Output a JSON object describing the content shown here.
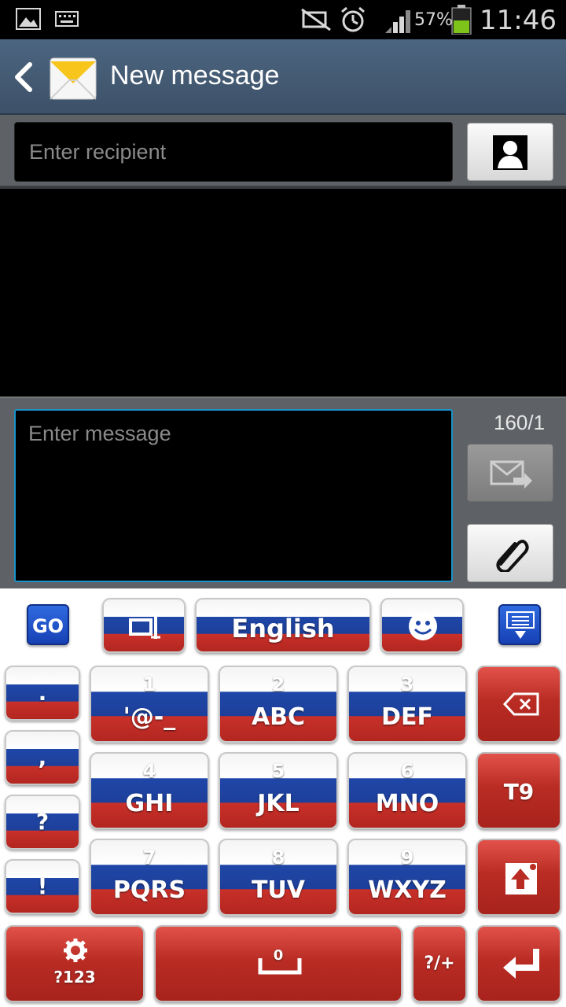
{
  "status_bar": {
    "battery_percent": "57%",
    "time": "11:46",
    "icons": [
      "gallery-icon",
      "keyboard-icon",
      "mute-icon",
      "alarm-icon",
      "signal-icon",
      "battery-icon"
    ]
  },
  "action_bar": {
    "title": "New message"
  },
  "recipient": {
    "placeholder": "Enter recipient"
  },
  "compose": {
    "placeholder": "Enter message",
    "counter": "160/1"
  },
  "keyboard": {
    "top_row": {
      "go_label": "GO",
      "language": "English"
    },
    "punct": [
      ".",
      ",",
      "?",
      "!"
    ],
    "keys": [
      {
        "num": "1",
        "letters": "'@-_"
      },
      {
        "num": "2",
        "letters": "ABC"
      },
      {
        "num": "3",
        "letters": "DEF"
      },
      {
        "num": "4",
        "letters": "GHI"
      },
      {
        "num": "5",
        "letters": "JKL"
      },
      {
        "num": "6",
        "letters": "MNO"
      },
      {
        "num": "7",
        "letters": "PQRS"
      },
      {
        "num": "8",
        "letters": "TUV"
      },
      {
        "num": "9",
        "letters": "WXYZ"
      }
    ],
    "t9_label": "T9",
    "sym_label": "?123",
    "space_num": "0",
    "symplus_label": "?/+",
    "colors": {
      "flag_white": "#ffffff",
      "flag_blue": "#1f47a8",
      "flag_red": "#c9302a",
      "go_blue": "#1741b5"
    }
  }
}
